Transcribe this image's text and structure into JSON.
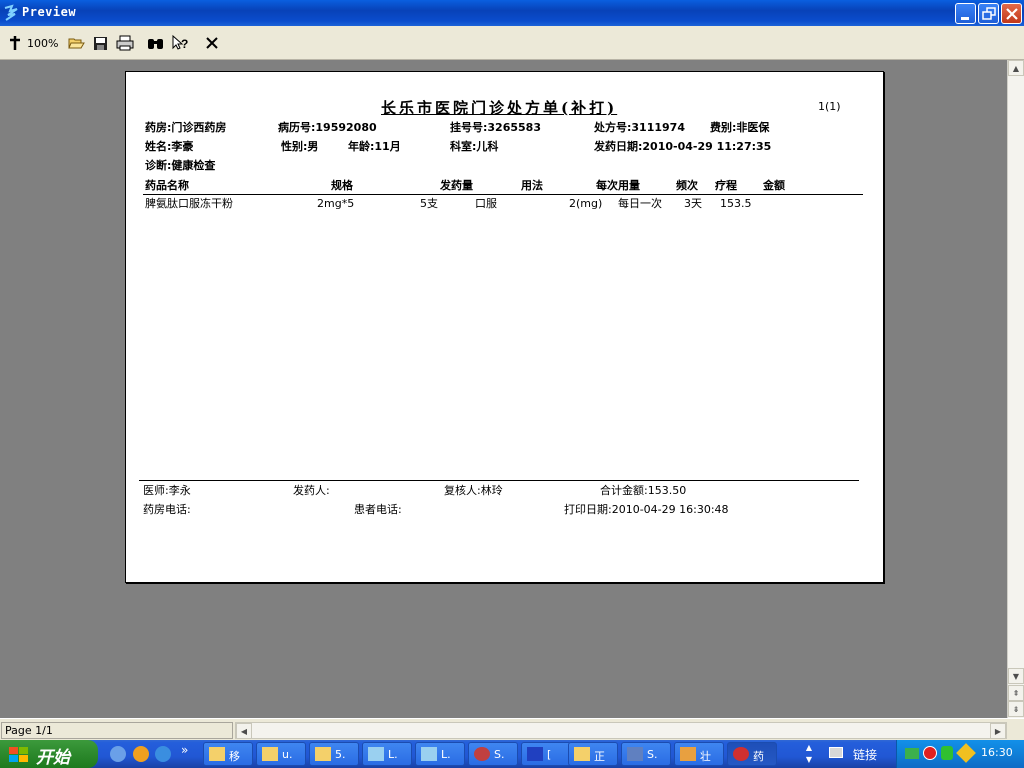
{
  "window": {
    "title": "Preview"
  },
  "toolbar": {
    "zoom": "100%"
  },
  "prescription": {
    "title": "长乐市医院门诊处方单(补打)",
    "page_no": "1(1)",
    "pharmacy": "药房:门诊西药房",
    "record_no": "病历号:19592080",
    "register_no": "挂号号:3265583",
    "rx_no": "处方号:3111974",
    "fee_type": "费别:非医保",
    "name": "姓名:李豪",
    "gender": "性别:男",
    "age": "年龄:11月",
    "dept": "科室:儿科",
    "dispense_date": "发药日期:2010-04-29 11:27:35",
    "diagnosis": "诊断:健康检查",
    "columns": [
      "药品名称",
      "规格",
      "发药量",
      "用法",
      "每次用量",
      "频次",
      "疗程",
      "金额"
    ],
    "rows": [
      {
        "drug": "脾氨肽口服冻干粉",
        "spec": "2mg*5",
        "qty": "5支",
        "usage": "口服",
        "dose": "2(mg)",
        "freq": "每日一次",
        "course": "3天",
        "amount": "153.5"
      }
    ],
    "doctor": "医师:李永",
    "dispenser": "发药人:",
    "checker": "复核人:林玲",
    "total": "合计金额:153.50",
    "pharmacy_phone": "药房电话:",
    "patient_phone": "患者电话:",
    "print_date": "打印日期:2010-04-29 16:30:48"
  },
  "statusbar": {
    "page": "Page 1/1"
  },
  "taskbar": {
    "start_label": "开始",
    "tasks": [
      "移",
      "u.",
      "5.",
      "L.",
      "L.",
      "S.",
      "[",
      "正",
      "S.",
      "壮",
      "药"
    ],
    "links_label": "链接",
    "clock": "16:30"
  },
  "icons": [
    "app-icon",
    "cross-icon",
    "open-folder-icon",
    "save-icon",
    "print-icon",
    "binoculars-icon",
    "help-cursor-icon",
    "close-icon"
  ]
}
